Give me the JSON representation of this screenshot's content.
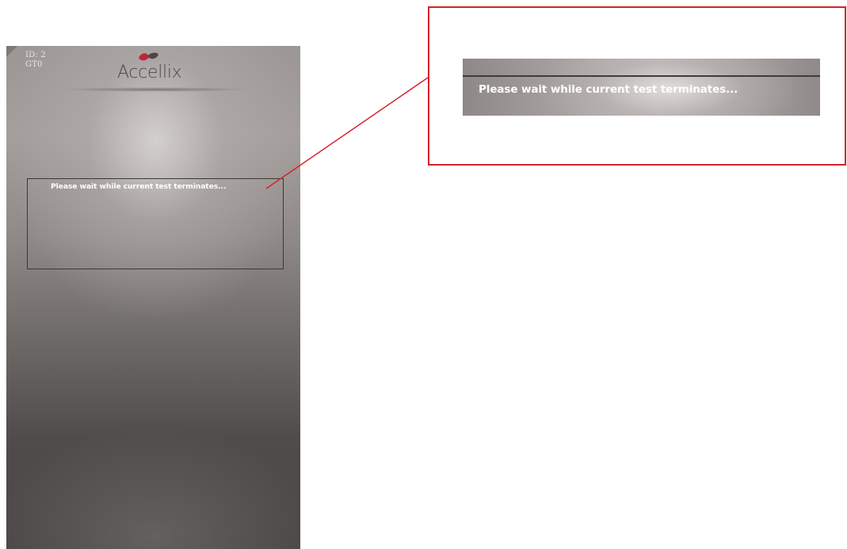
{
  "device": {
    "id_line": "ID: 2",
    "code_line": "GT0",
    "brand": "Accellix",
    "logo_icon": "accellix-drop-logo"
  },
  "message": {
    "text": "Please wait while current test terminates..."
  },
  "callout": {
    "text": "Please wait while current test terminates...",
    "frame_color": "#d7222a"
  },
  "colors": {
    "accent_red": "#d7222a",
    "message_text": "#ffffff",
    "logo_text": "#4c4846"
  }
}
